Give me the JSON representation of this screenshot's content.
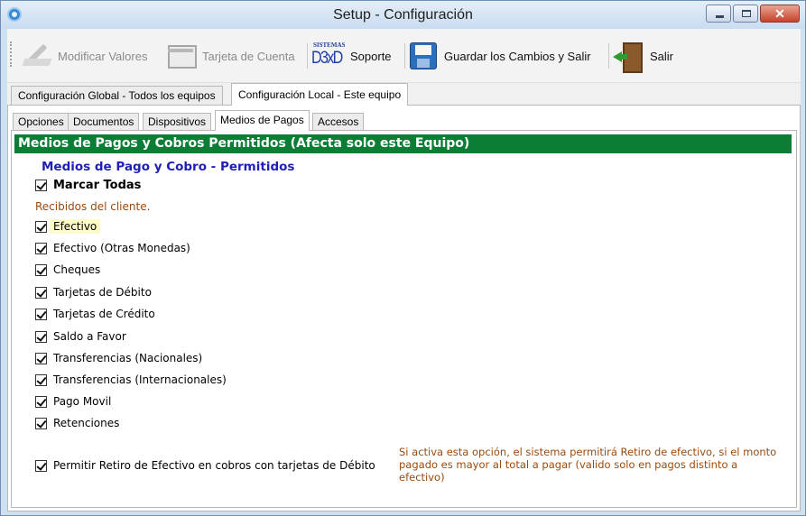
{
  "window": {
    "title": "Setup - Configuración",
    "close_glyph": "✕"
  },
  "toolbar": {
    "modify_label": "Modificar Valores",
    "card_label": "Tarjeta de Cuenta",
    "support_label": "Soporte",
    "support_logo_top": "SISTEMAS",
    "support_logo_main": "D3xD",
    "save_label": "Guardar los Cambios  y Salir",
    "exit_label": "Salir"
  },
  "outer_tabs": [
    {
      "label": "Configuración Global - Todos los equipos",
      "active": false
    },
    {
      "label": "Configuración Local - Este equipo",
      "active": true
    }
  ],
  "inner_tabs": [
    {
      "label": "Opciones",
      "active": false
    },
    {
      "label": "Documentos",
      "active": false
    },
    {
      "label": "Dispositivos",
      "active": false
    },
    {
      "label": "Medios de Pagos",
      "active": true
    },
    {
      "label": "Accesos",
      "active": false
    }
  ],
  "panel": {
    "header": "Medios de Pagos y Cobros Permitidos (Afecta solo este Equipo)",
    "section_title": "Medios de Pago y Cobro - Permitidos",
    "mark_all": "Marcar Todas",
    "subtext": "Recibidos del cliente.",
    "methods": [
      "Efectivo",
      "Efectivo (Otras Monedas)",
      "Cheques",
      "Tarjetas de Débito",
      "Tarjetas de Crédito",
      "Saldo a Favor",
      "Transferencias (Nacionales)",
      "Transferencias (Internacionales)",
      "Pago Movil",
      "Retenciones"
    ],
    "withdraw_label": "Permitir Retiro de Efectivo en cobros con tarjetas de Débito",
    "withdraw_note": "Si activa esta opción, el sistema permitirá Retiro de efectivo, si el monto pagado es mayor al total a pagar (valido solo en pagos distinto a efectivo)"
  },
  "colors": {
    "header_green": "#0c7d34",
    "section_blue": "#1f1fb8",
    "note_brown": "#9b4a0e",
    "highlight": "#fdfcc6"
  },
  "icons": [
    "settings-gear-icon",
    "edit-icon",
    "card-icon",
    "support-logo-icon",
    "save-disk-icon",
    "exit-door-icon"
  ]
}
